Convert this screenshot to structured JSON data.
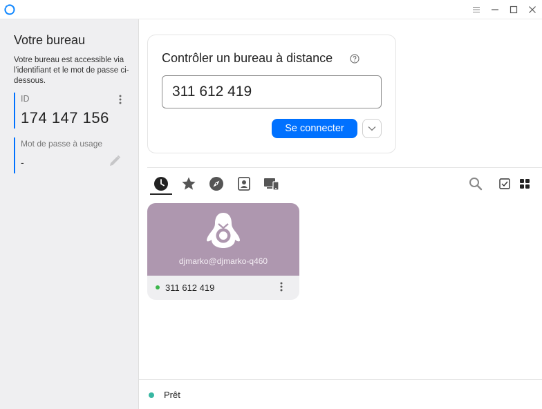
{
  "titlebar": {
    "icons": [
      "app-logo-icon",
      "menu-icon",
      "minimize-icon",
      "maximize-icon",
      "close-icon"
    ]
  },
  "sidebar": {
    "title": "Votre bureau",
    "description": "Votre bureau est accessible via l'identifiant et le mot de passe ci-dessous.",
    "id_label": "ID",
    "id_value": "174 147 156",
    "password_label": "Mot de passe à usage",
    "password_value": "-"
  },
  "connect": {
    "title": "Contrôler un bureau à distance",
    "input_value": "311 612 419",
    "button_label": "Se connecter"
  },
  "tabs": [
    {
      "name": "recent",
      "icon": "clock-icon",
      "active": true
    },
    {
      "name": "favorites",
      "icon": "star-icon",
      "active": false
    },
    {
      "name": "discovered",
      "icon": "compass-icon",
      "active": false
    },
    {
      "name": "address-book",
      "icon": "address-book-icon",
      "active": false
    },
    {
      "name": "group",
      "icon": "devices-icon",
      "active": false
    }
  ],
  "peers": [
    {
      "user": "djmarko@djmarko-q460",
      "id": "311 612 419",
      "os_icon": "linux-penguin-icon",
      "online": true
    }
  ],
  "status": {
    "text": "Prêt"
  },
  "colors": {
    "accent": "#0071ff",
    "sidebar_bg": "#efeff1",
    "peer_thumb": "#ae97af",
    "online": "#3bb54a",
    "status_ready": "#38b7a2"
  }
}
